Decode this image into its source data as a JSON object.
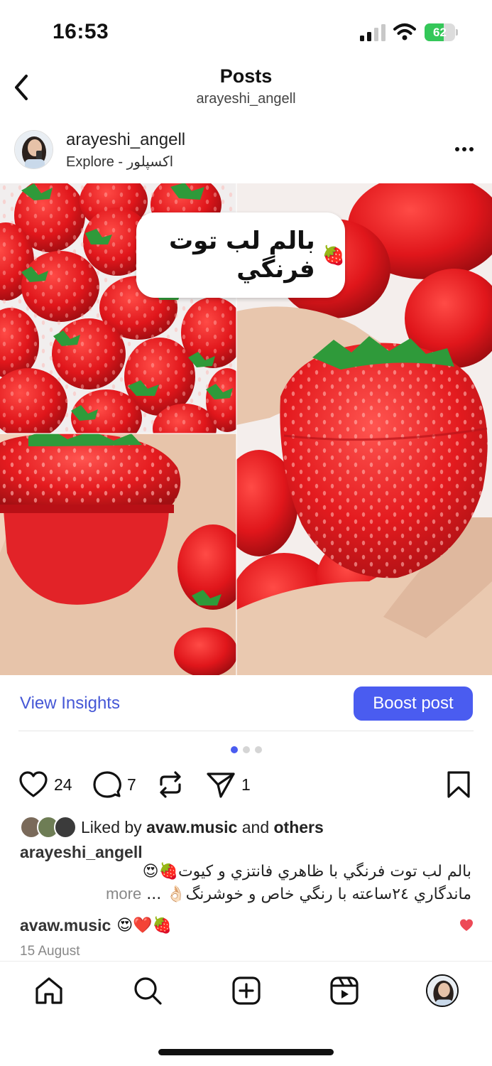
{
  "status_bar": {
    "time": "16:53",
    "battery_level": "62",
    "battery_fraction": 0.62,
    "battery_color": "#34c759",
    "icons": [
      "signal-icon",
      "wifi-icon",
      "battery-charging-icon"
    ]
  },
  "header": {
    "title": "Posts",
    "subtitle": "arayeshi_angell",
    "back_icon": "chevron-left-icon"
  },
  "post": {
    "author": "arayeshi_angell",
    "location": "Explore - اکسپلور",
    "image_title": "بالم لب توت فرنگي",
    "image_emoji": "🍓",
    "carousel": {
      "count": 3,
      "active": 1
    }
  },
  "actions": {
    "insights_label": "View Insights",
    "boost_label": "Boost post",
    "accent_color": "#4a5cf0"
  },
  "engagement": {
    "likes": "24",
    "comments": "7",
    "shares": "1"
  },
  "likes_row": {
    "prefix": "Liked by ",
    "user": "avaw.music",
    "middle": " and ",
    "others": "others"
  },
  "caption": {
    "user": "arayeshi_angell",
    "line1": "بالم لب توت فرنگي با ظاهري فانتزي و كيوت🍓😍",
    "line2": "ماندگاري ٢٤ساعته با رنگي خاص و خوشرنگ👌🏻 ...",
    "more": "more"
  },
  "comment": {
    "user": "avaw.music",
    "text": "😍❤️🍓"
  },
  "date": "15 August",
  "bottom_nav": [
    "home-icon",
    "search-icon",
    "create-icon",
    "reels-icon",
    "profile-avatar"
  ]
}
